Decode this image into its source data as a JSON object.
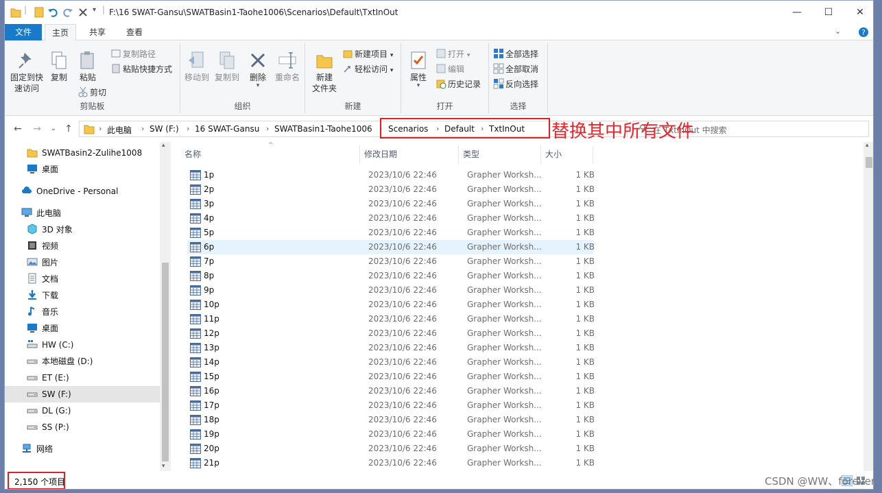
{
  "window": {
    "title": "F:\\16 SWAT-Gansu\\SWATBasin1-Taohe1006\\Scenarios\\Default\\TxtInOut",
    "minimize": "—",
    "maximize": "☐",
    "close": "✕"
  },
  "tabs": [
    "文件",
    "主页",
    "共享",
    "查看"
  ],
  "ribbon": {
    "clipboard": {
      "pin": "固定到快速访问",
      "pin_l1": "固定到快",
      "pin_l2": "速访问",
      "copy": "复制",
      "paste": "粘贴",
      "copy_path": "复制路径",
      "paste_shortcut": "粘贴快捷方式",
      "cut": "剪切",
      "label": "剪贴板"
    },
    "organize": {
      "move_to": "移动到",
      "copy_to": "复制到",
      "delete": "删除",
      "rename": "重命名",
      "label": "组织"
    },
    "new": {
      "new_folder_l1": "新建",
      "new_folder_l2": "文件夹",
      "new_item": "新建项目",
      "easy_access": "轻松访问",
      "label": "新建"
    },
    "open": {
      "properties": "属性",
      "open": "打开",
      "edit": "编辑",
      "history": "历史记录",
      "label": "打开"
    },
    "select": {
      "select_all": "全部选择",
      "select_none": "全部取消",
      "invert": "反向选择",
      "label": "选择"
    }
  },
  "address": {
    "crumbs": [
      "此电脑",
      "SW (F:)",
      "16 SWAT-Gansu",
      "SWATBasin1-Taohe1006",
      "Scenarios",
      "Default",
      "TxtInOut"
    ],
    "search_placeholder": "在 TxtInOut 中搜索"
  },
  "annotation": "替换其中所有文件",
  "nav": {
    "items": [
      {
        "label": "SWATBasin2-Zulihe1008",
        "icon": "folder-icon"
      },
      {
        "label": "桌面",
        "icon": "desktop-icon"
      },
      {
        "label": "OneDrive - Personal",
        "icon": "cloud-icon"
      },
      {
        "label": "此电脑",
        "icon": "computer-icon"
      },
      {
        "label": "3D 对象",
        "icon": "3d-objects-icon"
      },
      {
        "label": "视频",
        "icon": "video-icon"
      },
      {
        "label": "图片",
        "icon": "pictures-icon"
      },
      {
        "label": "文档",
        "icon": "documents-icon"
      },
      {
        "label": "下载",
        "icon": "download-icon"
      },
      {
        "label": "音乐",
        "icon": "music-icon"
      },
      {
        "label": "桌面",
        "icon": "desktop-icon"
      },
      {
        "label": "HW (C:)",
        "icon": "system-drive-icon"
      },
      {
        "label": "本地磁盘 (D:)",
        "icon": "drive-icon"
      },
      {
        "label": "ET (E:)",
        "icon": "drive-icon"
      },
      {
        "label": "SW (F:)",
        "icon": "drive-icon"
      },
      {
        "label": "DL (G:)",
        "icon": "drive-icon"
      },
      {
        "label": "SS (P:)",
        "icon": "drive-icon"
      },
      {
        "label": "网络",
        "icon": "network-icon"
      }
    ],
    "selected": "SW (F:)"
  },
  "columns": {
    "name": "名称",
    "date": "修改日期",
    "type": "类型",
    "size": "大小"
  },
  "files": [
    {
      "name": "1p",
      "date": "2023/10/6 22:46",
      "type": "Grapher Worksh...",
      "size": "1 KB"
    },
    {
      "name": "2p",
      "date": "2023/10/6 22:46",
      "type": "Grapher Worksh...",
      "size": "1 KB"
    },
    {
      "name": "3p",
      "date": "2023/10/6 22:46",
      "type": "Grapher Worksh...",
      "size": "1 KB"
    },
    {
      "name": "4p",
      "date": "2023/10/6 22:46",
      "type": "Grapher Worksh...",
      "size": "1 KB"
    },
    {
      "name": "5p",
      "date": "2023/10/6 22:46",
      "type": "Grapher Worksh...",
      "size": "1 KB"
    },
    {
      "name": "6p",
      "date": "2023/10/6 22:46",
      "type": "Grapher Worksh...",
      "size": "1 KB"
    },
    {
      "name": "7p",
      "date": "2023/10/6 22:46",
      "type": "Grapher Worksh...",
      "size": "1 KB"
    },
    {
      "name": "8p",
      "date": "2023/10/6 22:46",
      "type": "Grapher Worksh...",
      "size": "1 KB"
    },
    {
      "name": "9p",
      "date": "2023/10/6 22:46",
      "type": "Grapher Worksh...",
      "size": "1 KB"
    },
    {
      "name": "10p",
      "date": "2023/10/6 22:46",
      "type": "Grapher Worksh...",
      "size": "1 KB"
    },
    {
      "name": "11p",
      "date": "2023/10/6 22:46",
      "type": "Grapher Worksh...",
      "size": "1 KB"
    },
    {
      "name": "12p",
      "date": "2023/10/6 22:46",
      "type": "Grapher Worksh...",
      "size": "1 KB"
    },
    {
      "name": "13p",
      "date": "2023/10/6 22:46",
      "type": "Grapher Worksh...",
      "size": "1 KB"
    },
    {
      "name": "14p",
      "date": "2023/10/6 22:46",
      "type": "Grapher Worksh...",
      "size": "1 KB"
    },
    {
      "name": "15p",
      "date": "2023/10/6 22:46",
      "type": "Grapher Worksh...",
      "size": "1 KB"
    },
    {
      "name": "16p",
      "date": "2023/10/6 22:46",
      "type": "Grapher Worksh...",
      "size": "1 KB"
    },
    {
      "name": "17p",
      "date": "2023/10/6 22:46",
      "type": "Grapher Worksh...",
      "size": "1 KB"
    },
    {
      "name": "18p",
      "date": "2023/10/6 22:46",
      "type": "Grapher Worksh...",
      "size": "1 KB"
    },
    {
      "name": "19p",
      "date": "2023/10/6 22:46",
      "type": "Grapher Worksh...",
      "size": "1 KB"
    },
    {
      "name": "20p",
      "date": "2023/10/6 22:46",
      "type": "Grapher Worksh...",
      "size": "1 KB"
    },
    {
      "name": "21p",
      "date": "2023/10/6 22:46",
      "type": "Grapher Worksh...",
      "size": "1 KB"
    }
  ],
  "highlighted_file": "6p",
  "status": {
    "count": "2,150 个项目"
  },
  "watermark": "CSDN @WW、forever",
  "colors": {
    "accent": "#1979ca",
    "annotation_red": "#e02020",
    "highlight": "#e5f3ff"
  }
}
